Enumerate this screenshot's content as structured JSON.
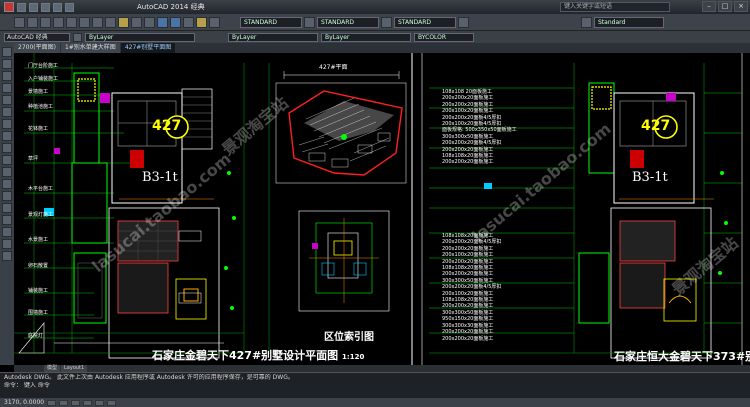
{
  "titlebar": {
    "title": "AutoCAD 2014    经典",
    "search_placeholder": "键入关键字或短语"
  },
  "toolbar": {
    "style_combo_1": "STANDARD",
    "style_combo_2": "STANDARD",
    "style_combo_3": "STANDARD",
    "style_combo_4": "Standard"
  },
  "layer_bar": {
    "workspace": "AutoCAD 经典",
    "layer": "ByLayer",
    "linetype": "ByLayer",
    "lineweight": "ByLayer",
    "color": "BYCOLOR"
  },
  "tabs": [
    {
      "label": "2700(平面图)"
    },
    {
      "label": "1#别水单建大样图"
    },
    {
      "label": "427#别墅平面图"
    }
  ],
  "drawing": {
    "left_plan_title": "石家庄金碧天下427#别墅设计平面图",
    "left_plan_scale": "1:120",
    "index_title": "区位索引图",
    "right_plan_title": "石家庄恒大金碧天下373#别墅",
    "house_number_left": "427",
    "house_number_right": "427",
    "type_label_left": "B3-1t",
    "type_label_right": "B3-1t",
    "site_dim": "427#平面",
    "spec_lines_top": [
      "108x108 20面板施工",
      "200x200x20面板施工",
      "200x200x20面板施工",
      "200x100x20面板施工",
      "200x200x20面板4/5厚扣",
      "200x100x20面板4/5厚扣",
      "面板规格: 500x350x50面板施工",
      "300x300x50面板施工",
      "200x200x20面板4/5厚扣",
      "200x200x20面板施工",
      "108x108x20面板施工",
      "200x200x20面板施工"
    ],
    "spec_lines_bottom": [
      "108x108x20面板施工",
      "200x200x20面板4/5厚扣",
      "200x200x20面板施工",
      "200x100x20面板施工",
      "200x200x20面板施工",
      "108x108x20面板施工",
      "200x200x20面板施工",
      "300x300x50面板施工",
      "200x200x20面板4/5厚扣",
      "200x100x20面板施工",
      "108x108x20面板施工",
      "200x200x20面板施工",
      "300x300x50面板施工",
      "950x150x20面板施工",
      "300x300x30面板施工",
      "200x200x20面板施工",
      "200x200x20面板施工"
    ],
    "left_annotations": [
      "门厅台阶施工",
      "入户铺装施工",
      "景墙施工",
      "种植池施工",
      "花钵施工",
      "草坪",
      "木平台施工",
      "景观灯施工",
      "水景施工",
      "卵石散置",
      "铺装施工",
      "围墙施工",
      "庭院灯"
    ]
  },
  "model_tabs": [
    "模型",
    "Layout1"
  ],
  "command_lines": [
    "Autodesk DWG。 此文件上次由 Autodesk 应用程序或 Autodesk 许可的应用程序保存，是可靠的 DWG。",
    "命令： 键入 命令"
  ],
  "status": {
    "coordinates": "3170, 0.0000"
  },
  "watermarks": [
    "lasucai.taobao.com",
    "景观淘宝站",
    "lasucai.taobao.com",
    "景观淘宝站"
  ]
}
